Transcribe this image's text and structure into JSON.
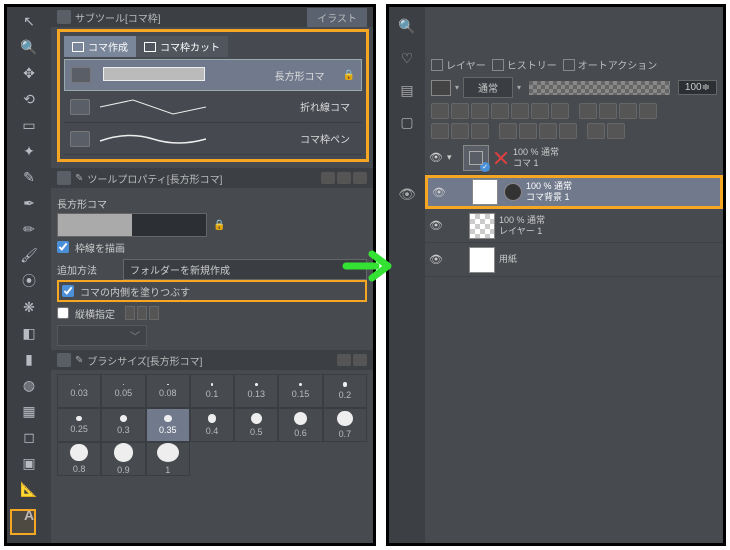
{
  "left": {
    "subtool_header": "サブツール[コマ枠]",
    "tab_right": "イラスト",
    "subtool_tabs": [
      "コマ作成",
      "コマ枠カット"
    ],
    "subtool_items": [
      {
        "label": "長方形コマ",
        "locked": true
      },
      {
        "label": "折れ線コマ",
        "locked": false
      },
      {
        "label": "コマ枠ペン",
        "locked": false
      }
    ],
    "tool_property_header": "ツールプロパティ[長方形コマ]",
    "property_name": "長方形コマ",
    "draw_border_label": "枠線を描画",
    "add_method_label": "追加方法",
    "add_method_value": "フォルダーを新規作成",
    "fill_inside_label": "コマの内側を塗りつぶす",
    "lock_aspect_label": "縦横指定",
    "brush_header": "ブラシサイズ[長方形コマ]",
    "brush_sizes": [
      0.03,
      0.05,
      0.08,
      0.1,
      0.13,
      0.15,
      0.2,
      0.25,
      0.3,
      0.35,
      0.4,
      0.5,
      0.6,
      0.7,
      0.8,
      0.9,
      1.0
    ]
  },
  "right": {
    "panel_tabs": [
      "レイヤー",
      "ヒストリー",
      "オートアクション"
    ],
    "blend_mode": "通常",
    "opacity": "100",
    "layers": [
      {
        "opacity": "100 % 通常",
        "name": "コマ 1",
        "folder": true,
        "redx": true
      },
      {
        "opacity": "100 % 通常",
        "name": "コマ背景 1",
        "selected": true,
        "highlighted": true,
        "mask": true
      },
      {
        "opacity": "100 % 通常",
        "name": "レイヤー 1",
        "check": true
      },
      {
        "opacity": "",
        "name": "用紙"
      }
    ]
  }
}
